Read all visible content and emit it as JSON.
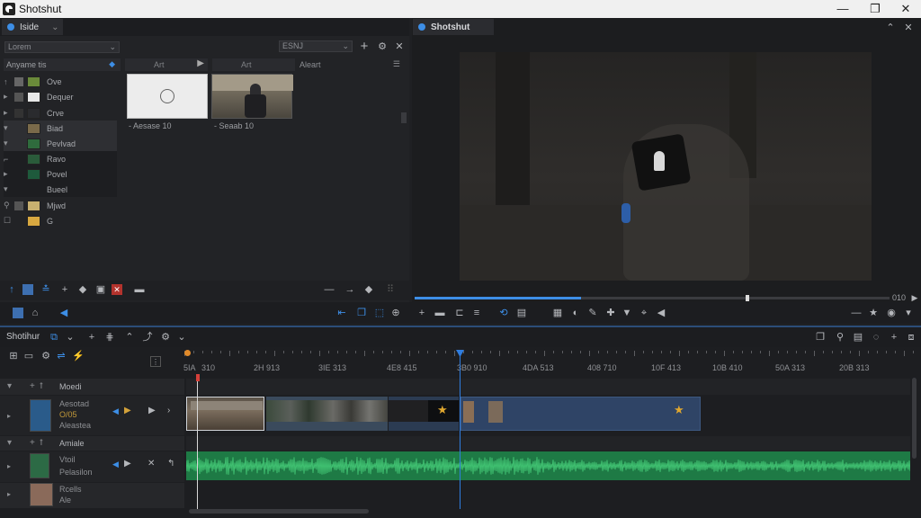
{
  "app": {
    "title": "Shotshut"
  },
  "window_controls": {
    "minimize": "—",
    "maximize": "❐",
    "close": "✕"
  },
  "media_panel": {
    "tab_label": "Iside",
    "tab_menu": "⌄",
    "project_dropdown": "Lorem",
    "tree_header": "Anyame tis",
    "tree_items": [
      {
        "label": "Ove"
      },
      {
        "label": "Dequer"
      },
      {
        "label": "Crve"
      },
      {
        "label": "Biad"
      },
      {
        "label": "Pevlvad"
      },
      {
        "label": "Ravo"
      },
      {
        "label": "Povel"
      },
      {
        "label": "Bueel"
      },
      {
        "label": "Mjwd"
      },
      {
        "label": "G"
      }
    ],
    "bin_header_1": "Art",
    "bin_header_2": "Art",
    "search_dropdown": "ESNJ",
    "bin_header_3": "Aleart",
    "assets": [
      {
        "caption": "- Aesase 10"
      },
      {
        "caption": "- Seaab 10"
      }
    ]
  },
  "viewer": {
    "tab_label": "Shotshut",
    "timecode": "010",
    "progress": 0.35
  },
  "timeline": {
    "tab_label": "Shotihur",
    "ruler_labels": [
      "5IA",
      "310",
      "2H 913",
      "3IE 313",
      "4E8 415",
      "3B0 910",
      "4DA 513",
      "408 710",
      "10F 413",
      "10B 410",
      "50A 313",
      "20B 313"
    ],
    "tracks": [
      {
        "label": "Moedi",
        "type": "video"
      },
      {
        "label": "Amiale",
        "type": "audio"
      }
    ],
    "clip_rows": [
      {
        "name": "Aesotad",
        "sub": "O/05",
        "sub2": "Aleastea"
      },
      {
        "name": "Vtoil",
        "sub": "Pelasilon"
      },
      {
        "name": "Rcells",
        "sub": "Ale"
      }
    ]
  },
  "colors": {
    "accent": "#3d8ee6",
    "video_track": "#2b3f5e",
    "audio_track": "#1e7a45",
    "playhead": "#2f7de0",
    "marker": "#d6403a"
  }
}
